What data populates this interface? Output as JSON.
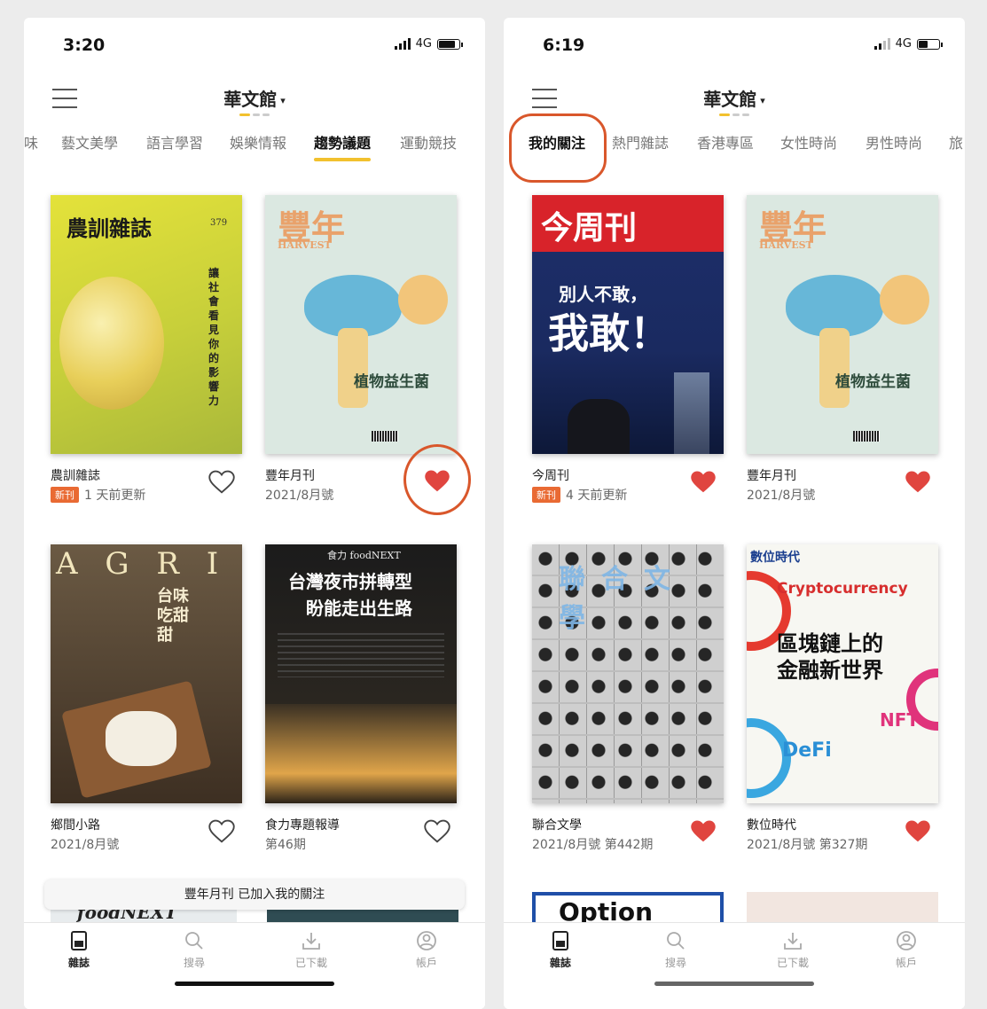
{
  "left": {
    "status": {
      "time": "3:20",
      "network": "4G"
    },
    "header": {
      "title": "華文館",
      "caret": "▾"
    },
    "tabs": [
      "味",
      "藝文美學",
      "語言學習",
      "娛樂情報",
      "趨勢議題",
      "運動競技"
    ],
    "active_tab": "趨勢議題",
    "magazines": [
      {
        "title": "農訓雜誌",
        "badge": "新刊",
        "subtitle": "1 天前更新",
        "favorited": false,
        "cover_lines": [
          "農訓雜誌",
          "379",
          "讓社會看見你的影響力"
        ]
      },
      {
        "title": "豐年月刊",
        "subtitle": "2021/8月號",
        "favorited": true,
        "cover_lines": [
          "豐年",
          "HARVEST",
          "植物益生菌"
        ]
      },
      {
        "title": "鄉間小路",
        "subtitle": "2021/8月號",
        "favorited": false,
        "cover_lines": [
          "A G R I",
          "台味吃甜甜"
        ]
      },
      {
        "title": "食力專題報導",
        "subtitle": "第46期",
        "favorited": false,
        "cover_lines": [
          "食力 foodNEXT",
          "台灣夜市拼轉型",
          "盼能走出生路"
        ]
      }
    ],
    "toast": "豐年月刊 已加入我的關注",
    "peek_text": "foodNEXT"
  },
  "right": {
    "status": {
      "time": "6:19",
      "network": "4G"
    },
    "header": {
      "title": "華文館",
      "caret": "▾"
    },
    "tabs": [
      "我的關注",
      "熱門雜誌",
      "香港專區",
      "女性時尚",
      "男性時尚",
      "旅"
    ],
    "active_tab": "我的關注",
    "magazines": [
      {
        "title": "今周刊",
        "badge": "新刊",
        "subtitle": "4 天前更新",
        "favorited": true,
        "cover_lines": [
          "今周刊",
          "別人不敢，",
          "我敢！"
        ]
      },
      {
        "title": "豐年月刊",
        "subtitle": "2021/8月號",
        "favorited": true,
        "cover_lines": [
          "豐年",
          "HARVEST",
          "植物益生菌"
        ]
      },
      {
        "title": "聯合文學",
        "subtitle": "2021/8月號 第442期",
        "favorited": true,
        "cover_lines": [
          "聯合文學"
        ]
      },
      {
        "title": "數位時代",
        "subtitle": "2021/8月號 第327期",
        "favorited": true,
        "cover_lines": [
          "數位時代",
          "Cryptocurrency",
          "區塊鏈上的",
          "金融新世界",
          "DeFi",
          "NFT"
        ]
      }
    ],
    "peek_text": "Option"
  },
  "nav": {
    "items": [
      "雜誌",
      "搜尋",
      "已下載",
      "帳戶"
    ],
    "active": "雜誌"
  },
  "colors": {
    "accent": "#f2c12e",
    "highlight": "#d9572b",
    "heart": "#e0453f",
    "badge": "#e96a33"
  }
}
